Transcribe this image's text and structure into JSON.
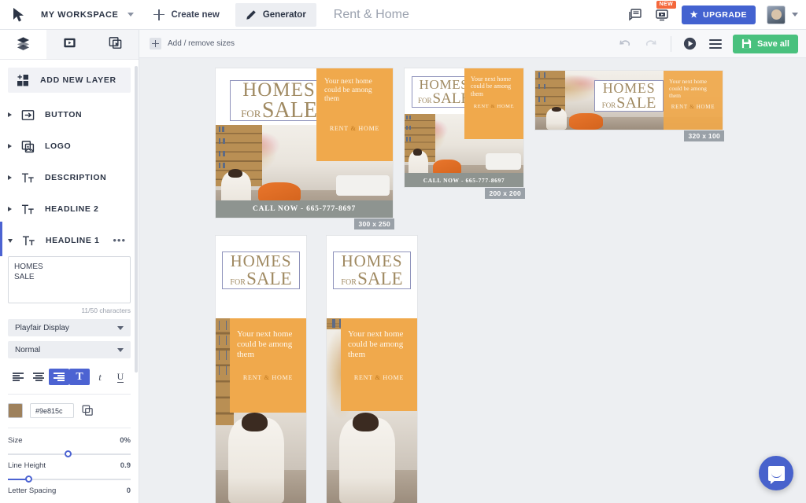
{
  "topbar": {
    "logo_icon": "cursor-logo-icon",
    "workspace": "MY WORKSPACE",
    "workspace_caret": "chevron-down-icon",
    "create_new": "Create new",
    "create_new_icon": "plus-icon",
    "generator_tab": "Generator",
    "generator_icon": "pencil-icon",
    "document_title": "Rent & Home",
    "feedback_icon": "comment-icon",
    "tutorial_icon": "video-player-icon",
    "new_badge": "NEW",
    "upgrade_label": "UPGRADE",
    "upgrade_icon": "star-icon",
    "upgrade_color": "#4362d0",
    "avatar_icon": "user-avatar",
    "avatar_caret": "chevron-down-icon"
  },
  "sidebar": {
    "tabs": [
      {
        "name": "layers-tab",
        "icon": "layers-stack-icon",
        "active": true
      },
      {
        "name": "media-tab",
        "icon": "video-frame-icon",
        "active": false
      },
      {
        "name": "templates-tab",
        "icon": "duplicate-frames-icon",
        "active": false
      }
    ],
    "add_new_layer": "ADD NEW LAYER",
    "add_new_layer_icon": "add-layer-icon",
    "layers": [
      {
        "label": "BUTTON",
        "icon": "button-arrow-icon",
        "expanded": false
      },
      {
        "label": "LOGO",
        "icon": "image-stack-icon",
        "expanded": false
      },
      {
        "label": "DESCRIPTION",
        "icon": "text-type-icon",
        "expanded": false
      },
      {
        "label": "HEADLINE 2",
        "icon": "text-type-icon",
        "expanded": false
      },
      {
        "label": "HEADLINE 1",
        "icon": "text-type-icon",
        "expanded": true
      }
    ],
    "selected_layer_menu_icon": "more-options-icon",
    "editor": {
      "text_value": "HOMES\nSALE",
      "char_count": "11/50 characters",
      "font_family": "Playfair Display",
      "font_weight": "Normal",
      "align_buttons": [
        {
          "name": "align-left-button",
          "icon": "align-left-icon",
          "active": false
        },
        {
          "name": "align-center-button",
          "icon": "align-center-icon",
          "active": false
        },
        {
          "name": "align-right-button",
          "icon": "align-right-icon",
          "active": true
        },
        {
          "name": "bold-button",
          "icon": "bold-T-icon",
          "active": true
        },
        {
          "name": "italic-button",
          "icon": "italic-icon",
          "active": false
        },
        {
          "name": "underline-button",
          "icon": "underline-icon",
          "active": false
        }
      ],
      "color_hex": "#9e815c",
      "copy_icon": "copy-icon",
      "sliders": [
        {
          "label": "Size",
          "value": "0%",
          "pos": 50,
          "fill": 0
        },
        {
          "label": "Line Height",
          "value": "0.9",
          "pos": 18,
          "fill": 18
        },
        {
          "label": "Letter Spacing",
          "value": "0",
          "pos": 0,
          "fill": 0
        }
      ]
    }
  },
  "canvas_toolbar": {
    "add_remove_sizes": "Add / remove sizes",
    "add_remove_sizes_icon": "plus-square-icon",
    "undo_icon": "undo-arrow-icon",
    "redo_icon": "redo-arrow-icon",
    "play_icon": "play-circle-icon",
    "menu_icon": "hamburger-menu-icon",
    "save_all": "Save all",
    "save_all_icon": "floppy-disk-icon",
    "save_all_color": "#49c17e"
  },
  "creative": {
    "headline_line1": "HOMES",
    "headline_for": "FOR",
    "headline_line2": "SALE",
    "description": "Your next home could be among them",
    "logo_left": "RENT",
    "logo_amp": "&",
    "logo_right": "HOME",
    "cta": "CALL NOW - 665-777-8697",
    "accent_orange": "#f0a94c",
    "cta_bar_color": "#8e9490"
  },
  "banners": [
    {
      "name": "banner-300x250",
      "size_label": "300 x 250"
    },
    {
      "name": "banner-200x200",
      "size_label": "200 x 200"
    },
    {
      "name": "banner-320x100",
      "size_label": "320 x 100"
    },
    {
      "name": "banner-160x600-a",
      "size_label": ""
    },
    {
      "name": "banner-160x600-b",
      "size_label": ""
    }
  ],
  "chat": {
    "icon": "chat-bubble-icon",
    "color": "#4862cc"
  }
}
